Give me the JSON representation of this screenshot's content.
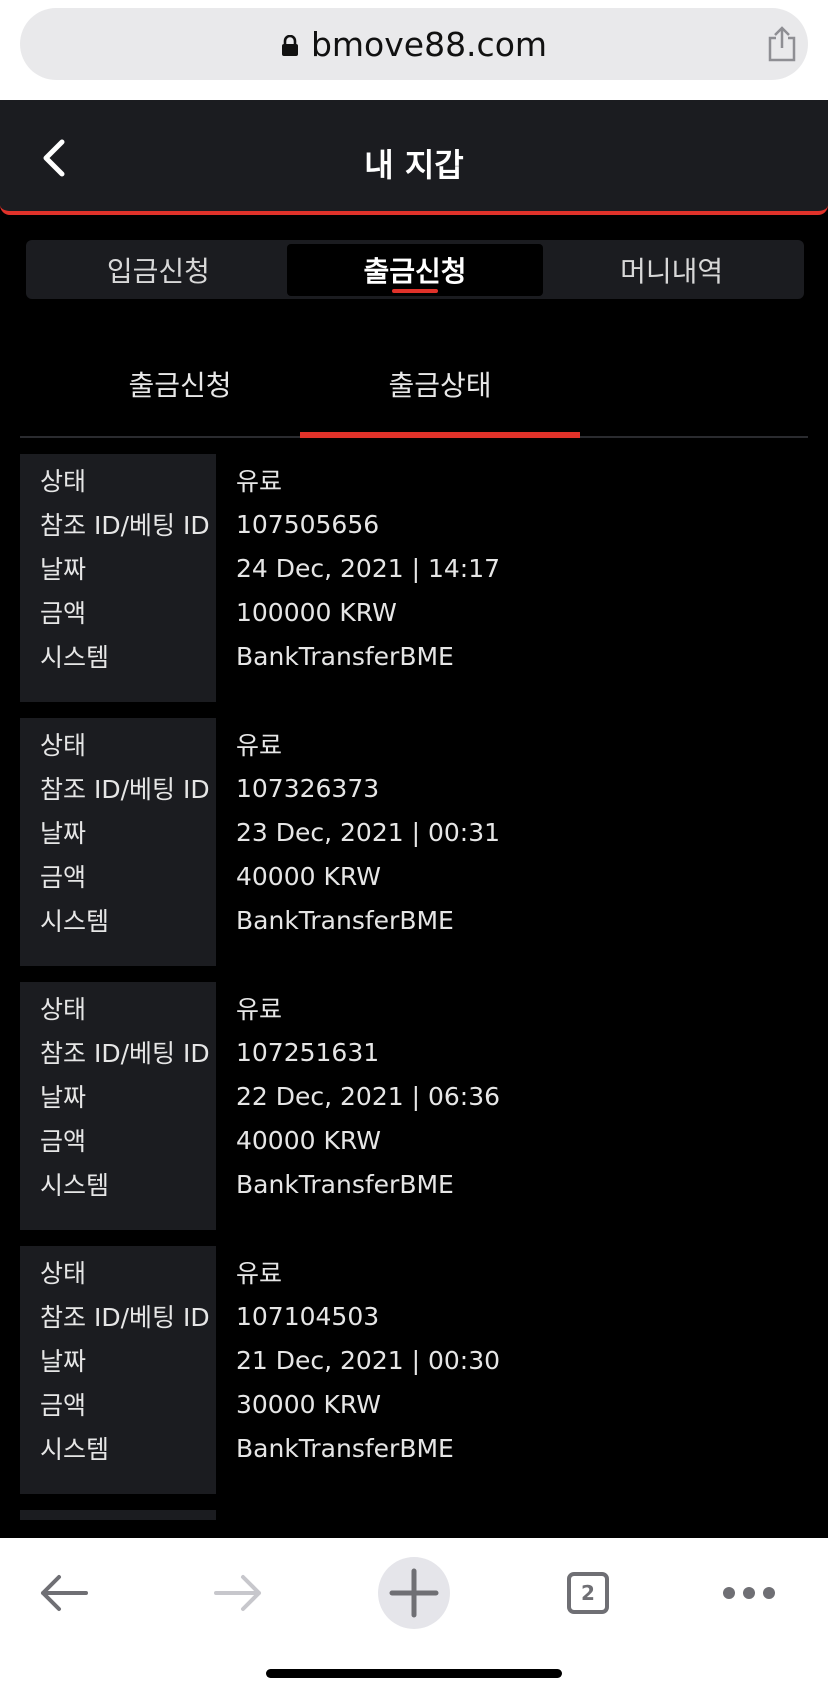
{
  "browser": {
    "url": "bmove88.com",
    "tab_count": "2"
  },
  "header": {
    "title": "내 지갑"
  },
  "main_tabs": [
    {
      "label": "입금신청",
      "active": false
    },
    {
      "label": "출금신청",
      "active": true
    },
    {
      "label": "머니내역",
      "active": false
    }
  ],
  "sub_tabs": [
    {
      "label": "출금신청",
      "active": false
    },
    {
      "label": "출금상태",
      "active": true
    }
  ],
  "field_labels": {
    "status": "상태",
    "ref_id": "참조 ID/베팅 ID",
    "date": "날짜",
    "amount": "금액",
    "system": "시스템"
  },
  "records": [
    {
      "status": "유료",
      "ref_id": "107505656",
      "date": "24 Dec, 2021 | 14:17",
      "amount": "100000 KRW",
      "system": "BankTransferBME"
    },
    {
      "status": "유료",
      "ref_id": "107326373",
      "date": "23 Dec, 2021 | 00:31",
      "amount": "40000 KRW",
      "system": "BankTransferBME"
    },
    {
      "status": "유료",
      "ref_id": "107251631",
      "date": "22 Dec, 2021 | 06:36",
      "amount": "40000 KRW",
      "system": "BankTransferBME"
    },
    {
      "status": "유료",
      "ref_id": "107104503",
      "date": "21 Dec, 2021 | 00:30",
      "amount": "30000 KRW",
      "system": "BankTransferBME"
    }
  ],
  "colors": {
    "accent": "#e0322a",
    "panel": "#1b1c20",
    "background": "#000000"
  },
  "icons": [
    "lock-icon",
    "share-icon",
    "back-icon",
    "arrow-left-icon",
    "arrow-right-icon",
    "plus-icon",
    "tabs-icon",
    "more-icon"
  ]
}
